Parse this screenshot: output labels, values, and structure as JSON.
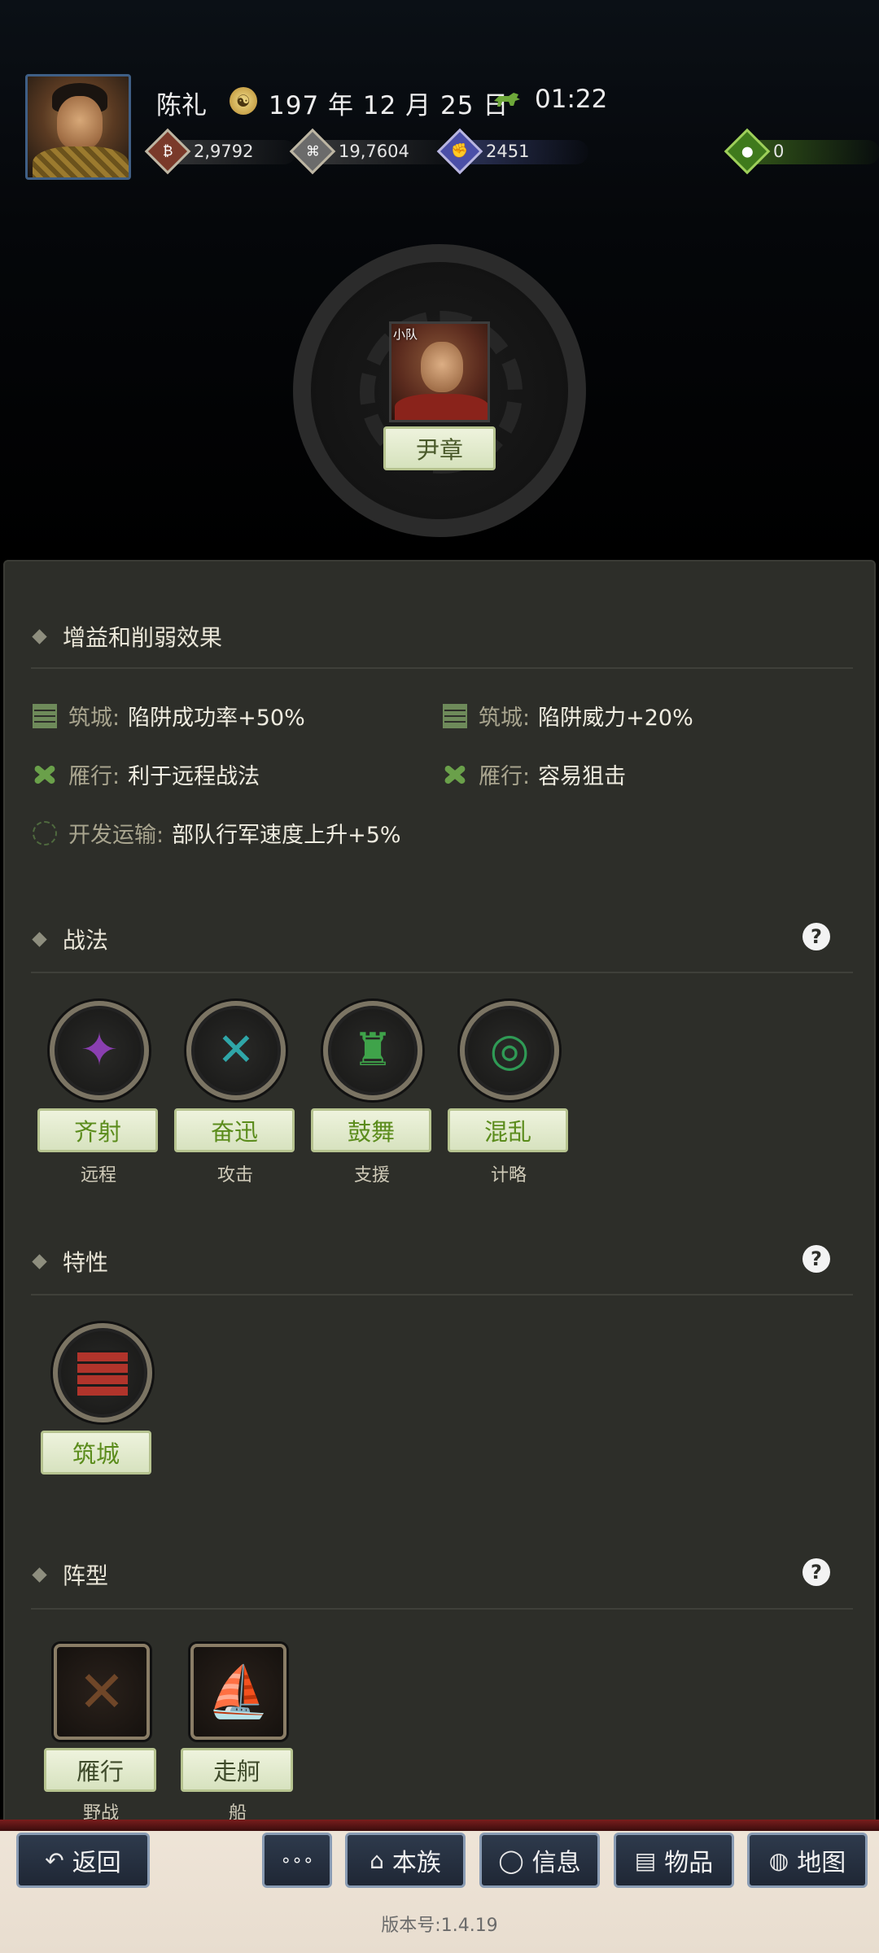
{
  "header": {
    "player_name": "陈礼",
    "date": "197 年 12 月 25 日",
    "time": "01:22",
    "resources": [
      {
        "icon": "coin-icon",
        "value": "2,9792"
      },
      {
        "icon": "grain-icon",
        "value": "19,7604"
      },
      {
        "icon": "strength-icon",
        "value": "2451"
      },
      {
        "icon": "bag-icon",
        "value": "0"
      }
    ]
  },
  "officer": {
    "tag": "小队",
    "name": "尹章"
  },
  "sections": {
    "effects": {
      "title": "增益和削弱效果",
      "items": [
        {
          "icon": "wall-icon",
          "key": "筑城:",
          "desc": "陷阱成功率+50%"
        },
        {
          "icon": "wall-icon",
          "key": "筑城:",
          "desc": "陷阱威力+20%"
        },
        {
          "icon": "geese-icon",
          "key": "雁行:",
          "desc": "利于远程战法"
        },
        {
          "icon": "geese-icon",
          "key": "雁行:",
          "desc": "容易狙击"
        },
        {
          "icon": "transport-icon",
          "key": "开发运输:",
          "desc": "部队行军速度上升+5%"
        }
      ]
    },
    "tactics": {
      "title": "战法",
      "items": [
        {
          "name": "齐射",
          "category": "远程",
          "color": "#8a3fb0"
        },
        {
          "name": "奋迅",
          "category": "攻击",
          "color": "#2fa6a8"
        },
        {
          "name": "鼓舞",
          "category": "支援",
          "color": "#3fa34a"
        },
        {
          "name": "混乱",
          "category": "计略",
          "color": "#2f9a55"
        }
      ]
    },
    "traits": {
      "title": "特性",
      "items": [
        {
          "name": "筑城",
          "color": "#a8322a"
        }
      ]
    },
    "formations": {
      "title": "阵型",
      "items": [
        {
          "name": "雁行",
          "category": "野战"
        },
        {
          "name": "走舸",
          "category": "船"
        }
      ]
    }
  },
  "nav": {
    "back": "返回",
    "more": "∘∘∘",
    "clan": "本族",
    "info": "信息",
    "items": "物品",
    "map": "地图"
  },
  "version": "版本号:1.4.19"
}
